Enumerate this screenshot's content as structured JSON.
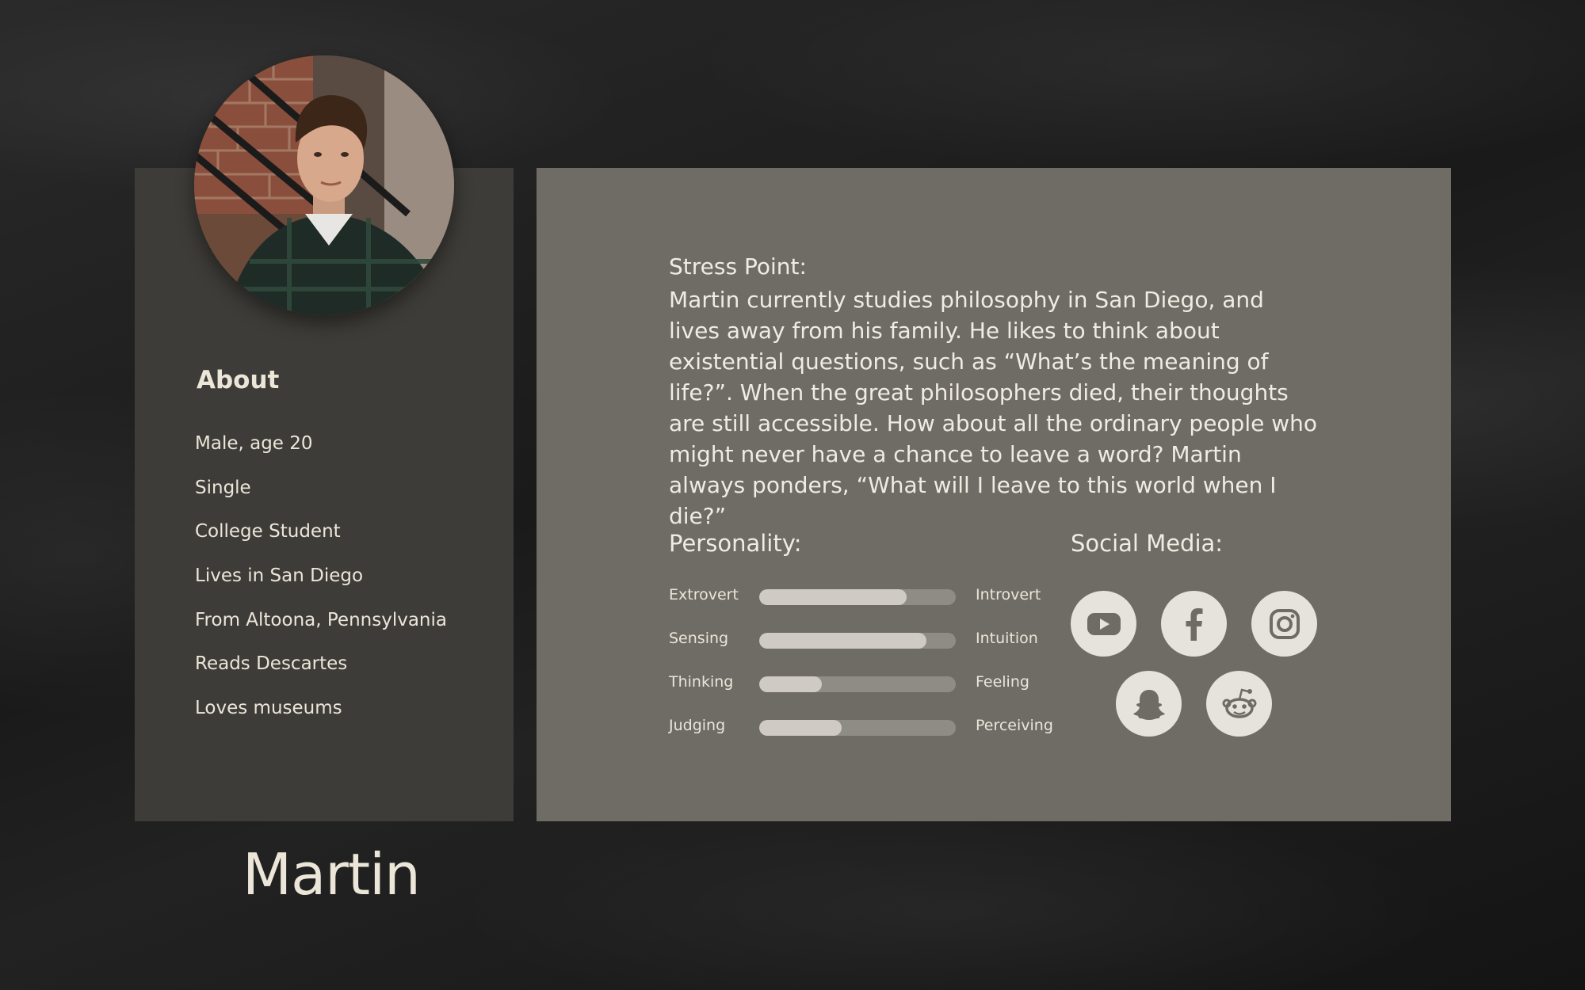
{
  "about": {
    "heading": "About",
    "items": [
      "Male, age 20",
      "Single",
      "College Student",
      "Lives in San Diego",
      "From Altoona, Pennsylvania",
      "Reads Descartes",
      "Loves museums"
    ]
  },
  "name": "Martin",
  "stress": {
    "label": "Stress Point:",
    "body": "Martin currently studies philosophy in San Diego, and lives away from his family. He likes to think about existential questions, such as “What’s the meaning of life?”. When the great philosophers died, their thoughts are still accessible. How about all the ordinary people who might never have a chance to leave a word? Martin always ponders, “What will I leave to this world when I die?”"
  },
  "personality": {
    "label": "Personality:",
    "traits": [
      {
        "left": "Extrovert",
        "right": "Introvert",
        "level": 0.75
      },
      {
        "left": "Sensing",
        "right": "Intuition",
        "level": 0.85
      },
      {
        "left": "Thinking",
        "right": "Feeling",
        "level": 0.32
      },
      {
        "left": "Judging",
        "right": "Perceiving",
        "level": 0.42
      }
    ]
  },
  "social": {
    "label": "Social Media:",
    "icons": [
      "youtube-icon",
      "facebook-icon",
      "instagram-icon",
      "snapchat-icon",
      "reddit-icon"
    ]
  },
  "colors": {
    "left_panel": "#3d3c38",
    "main_panel": "#6f6b65",
    "text": "#ece6d9",
    "bar_track": "#8f8c86",
    "bar_fill": "#cfcbc4",
    "icon_bg": "#e6e2dc",
    "icon_fg": "#6f6b65"
  }
}
